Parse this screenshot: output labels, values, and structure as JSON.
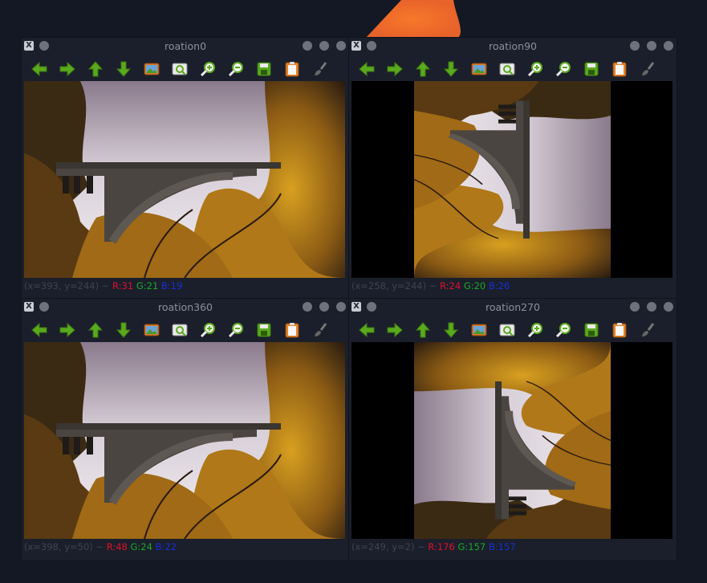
{
  "windows": [
    {
      "title": "roation0",
      "status": {
        "coords": "(x=393, y=244) ~",
        "r": "R:31",
        "g": "G:21",
        "b": "B:19"
      }
    },
    {
      "title": "roation90",
      "status": {
        "coords": "(x=258, y=244) ~",
        "r": "R:24",
        "g": "G:20",
        "b": "B:26"
      }
    },
    {
      "title": "roation360",
      "status": {
        "coords": "(x=398, y=50) ~",
        "r": "R:48",
        "g": "G:24",
        "b": "B:22"
      }
    },
    {
      "title": "roation270",
      "status": {
        "coords": "(x=249, y=2) ~",
        "r": "R:176",
        "g": "G:157",
        "b": "B:157"
      }
    }
  ],
  "titlebar": {
    "close_glyph": "X"
  },
  "toolbar": {
    "icons": [
      "arrow-left-icon",
      "arrow-right-icon",
      "arrow-up-icon",
      "arrow-down-icon",
      "image-icon",
      "zoom-fit-icon",
      "zoom-in-icon",
      "zoom-out-icon",
      "save-icon",
      "clipboard-icon",
      "brush-icon"
    ]
  },
  "colors": {
    "background": "#141824",
    "accent": "#f07a24",
    "icon_green": "#5aa91e"
  }
}
